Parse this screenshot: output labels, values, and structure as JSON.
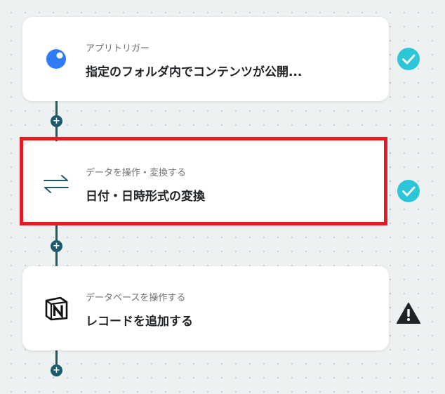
{
  "flow": {
    "steps": [
      {
        "category": "アプリトリガー",
        "title": "指定のフォルダ内でコンテンツが公開...",
        "icon": "blue-dot-app-icon",
        "status": "complete"
      },
      {
        "category": "データを操作・変換する",
        "title": "日付・日時形式の変換",
        "icon": "convert-arrows-icon",
        "status": "complete"
      },
      {
        "category": "データベースを操作する",
        "title": "レコードを追加する",
        "icon": "notion-icon",
        "status": "warning"
      }
    ],
    "add_symbol": "+"
  },
  "colors": {
    "background": "#eef1f2",
    "connector": "#1d5b6b",
    "check": "#2cc6d8",
    "selected_border": "#e11d24",
    "trigger_icon": "#2f7cf6",
    "convert_icon": "#1d5b6b",
    "warning": "#1f2326"
  }
}
